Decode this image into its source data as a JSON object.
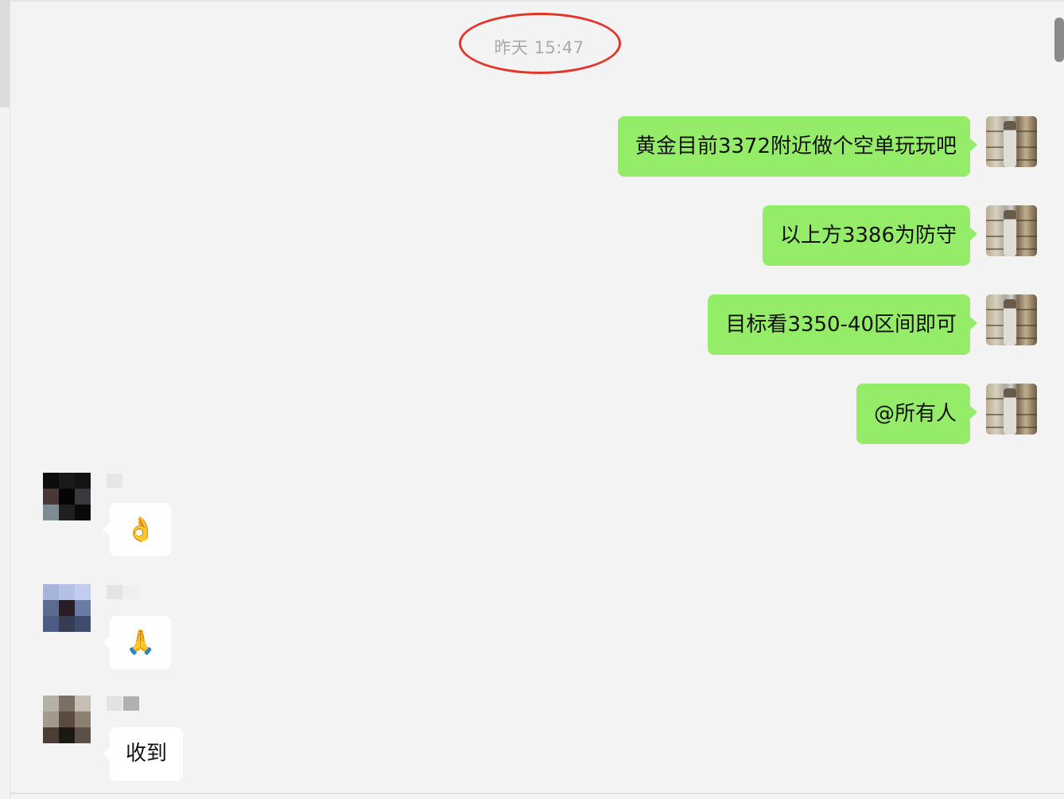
{
  "timestamp": "昨天 15:47",
  "outgoing_messages": [
    {
      "text": "黄金目前3372附近做个空单玩玩吧"
    },
    {
      "text": "以上方3386为防守"
    },
    {
      "text": "目标看3350-40区间即可"
    },
    {
      "text": "@所有人"
    }
  ],
  "incoming_messages": [
    {
      "emoji": "👌",
      "avatar": "pixelated-dark",
      "name": "pixelated"
    },
    {
      "emoji": "🙏",
      "avatar": "pixelated-blue",
      "name": "pixelated"
    },
    {
      "text": "收到",
      "avatar": "pixelated-brown",
      "name": "pixelated"
    }
  ],
  "colors": {
    "background": "#f3f3f3",
    "outgoing_bubble": "#95ec69",
    "incoming_bubble": "#ffffff",
    "highlight_circle": "#e2352a",
    "timestamp_text": "#a9a9a9"
  }
}
